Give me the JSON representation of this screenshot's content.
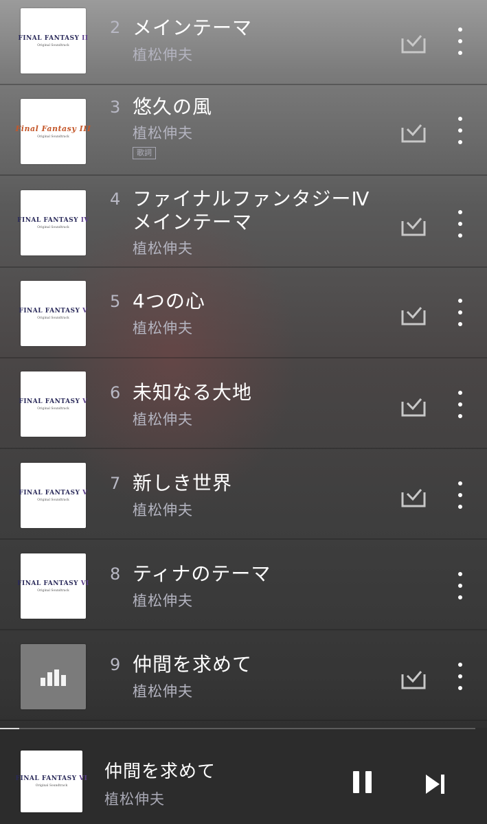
{
  "tracks": [
    {
      "number": "2",
      "title": "メインテーマ",
      "artist": "植松伸夫",
      "art": "FINAL FANTASY II",
      "downloaded": true
    },
    {
      "number": "3",
      "title": "悠久の風",
      "artist": "植松伸夫",
      "lyrics_badge": "歌詞",
      "art": "FINAL FANTASY III",
      "downloaded": true
    },
    {
      "number": "4",
      "title": "ファイナルファンタジーⅣ\nメインテーマ",
      "artist": "植松伸夫",
      "art": "FINAL FANTASY IV",
      "downloaded": true
    },
    {
      "number": "5",
      "title": "4つの心",
      "artist": "植松伸夫",
      "art": "FINAL FANTASY V",
      "downloaded": true
    },
    {
      "number": "6",
      "title": "未知なる大地",
      "artist": "植松伸夫",
      "art": "FINAL FANTASY V",
      "downloaded": true
    },
    {
      "number": "7",
      "title": "新しき世界",
      "artist": "植松伸夫",
      "art": "FINAL FANTASY V",
      "downloaded": true
    },
    {
      "number": "8",
      "title": "ティナのテーマ",
      "artist": "植松伸夫",
      "art": "FINAL FANTASY VI",
      "downloaded": false
    },
    {
      "number": "9",
      "title": "仲間を求めて",
      "artist": "植松伸夫",
      "art": "FINAL FANTASY VI",
      "downloaded": true,
      "now_playing": true
    }
  ],
  "art_labels": {
    "ff2_top": "FINAL FANTASY",
    "ff2_roman": "II",
    "ff3_top": "Final Fantasy",
    "ff3_roman": "III",
    "ff4_top": "FINAL FANTASY",
    "ff4_roman": "IV",
    "ff5_top": "FINAL FANTASY",
    "ff5_roman": "V",
    "ff6_top": "FINAL FANTASY",
    "ff6_roman": "VI",
    "ost": "Original Soundtrack"
  },
  "player": {
    "title": "仲間を求めて",
    "artist": "植松伸夫",
    "progress_fraction": 0.04
  },
  "colors": {
    "accent": "#ffffff",
    "secondary_text": "#b4b4c0"
  },
  "icons": {
    "download": "download-done-icon",
    "more": "more-vertical-icon",
    "pause": "pause-icon",
    "next": "skip-next-icon",
    "playing": "equalizer-icon"
  }
}
